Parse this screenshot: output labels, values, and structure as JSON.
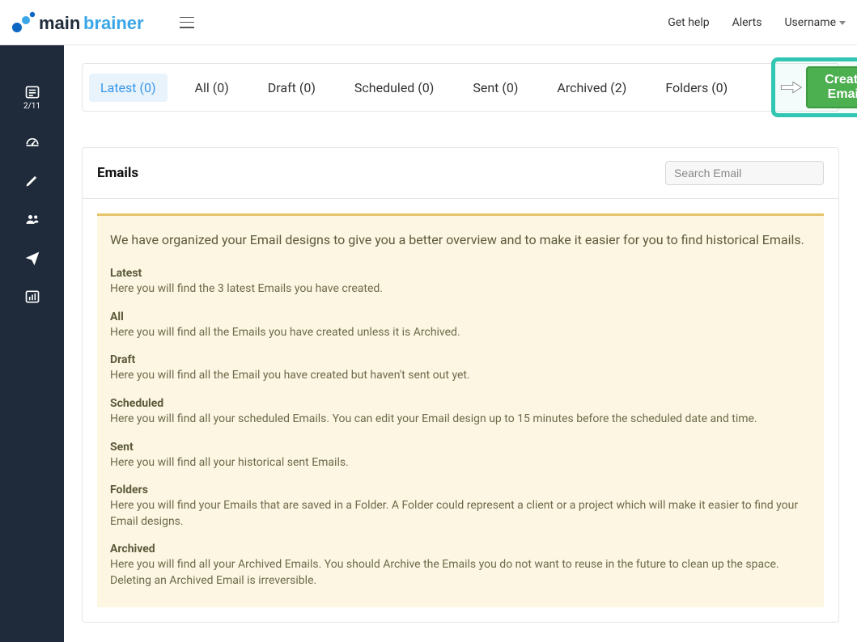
{
  "header": {
    "get_help": "Get help",
    "alerts": "Alerts",
    "username": "Username"
  },
  "sidebar": {
    "counter": "2/11"
  },
  "tabs": {
    "latest": "Latest (0)",
    "all": "All (0)",
    "draft": "Draft (0)",
    "scheduled": "Scheduled (0)",
    "sent": "Sent (0)",
    "archived": "Archived (2)",
    "folders": "Folders (0)"
  },
  "create_button": "Create Email",
  "emails": {
    "title": "Emails",
    "search_placeholder": "Search Email"
  },
  "info": {
    "intro": "We have organized your Email designs to give you a better overview and to make it easier for you to find historical Emails.",
    "sections": {
      "latest": {
        "label": "Latest",
        "desc": "Here you will find the 3 latest Emails you have created."
      },
      "all": {
        "label": "All",
        "desc": "Here you will find all the Emails you have created unless it is Archived."
      },
      "draft": {
        "label": "Draft",
        "desc": "Here you will find all the Email you have created but haven't sent out yet."
      },
      "scheduled": {
        "label": "Scheduled",
        "desc": "Here you will find all your scheduled Emails. You can edit your Email design up to 15 minutes before the scheduled date and time."
      },
      "sent": {
        "label": "Sent",
        "desc": "Here you will find all your historical sent Emails."
      },
      "folders": {
        "label": "Folders",
        "desc": "Here you will find your Emails that are saved in a Folder. A Folder could represent a client or a project which will make it easier to find your Email designs."
      },
      "archived": {
        "label": "Archived",
        "desc": "Here you will find all your Archived Emails. You should Archive the Emails you do not want to reuse in the future to clean up the space. Deleting an Archived Email is irreversible."
      }
    }
  }
}
